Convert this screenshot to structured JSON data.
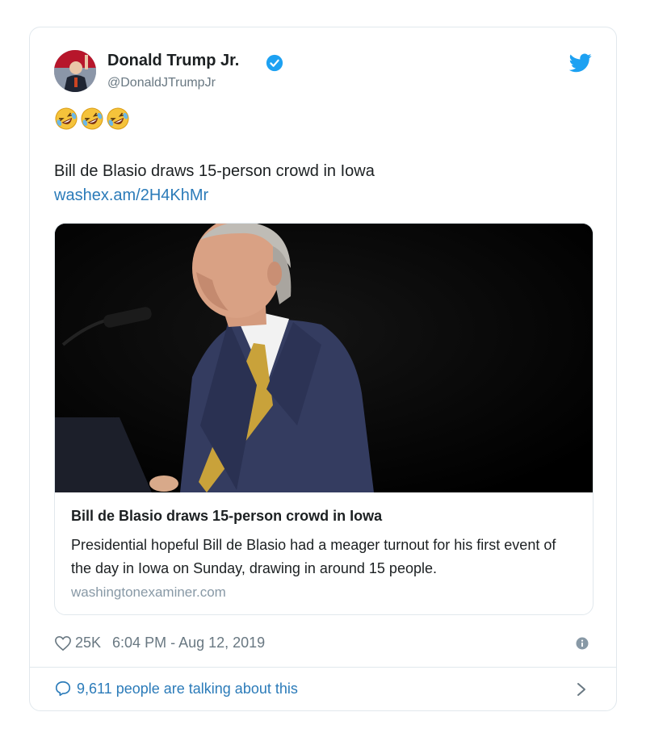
{
  "author": {
    "name": "Donald Trump Jr.",
    "handle": "@DonaldJTrumpJr",
    "verified_icon": "verified-badge-icon"
  },
  "tweet": {
    "emojis": [
      "🤣",
      "🤣",
      "🤣"
    ],
    "text": "Bill de Blasio draws 15-person crowd in Iowa",
    "link": "washex.am/2H4KhMr"
  },
  "link_card": {
    "title": "Bill de Blasio draws 15-person crowd in Iowa",
    "description": "Presidential hopeful Bill de Blasio had a meager turnout for his first event of the day in Iowa on Sunday, drawing in around 15 people.",
    "domain": "washingtonexaminer.com"
  },
  "meta": {
    "likes": "25K",
    "timestamp": "6:04 PM - Aug 12, 2019"
  },
  "footer": {
    "talking": "9,611 people are talking about this"
  },
  "colors": {
    "link_blue": "#2b7bb9",
    "twitter_blue": "#1da1f2",
    "muted": "#697882"
  }
}
